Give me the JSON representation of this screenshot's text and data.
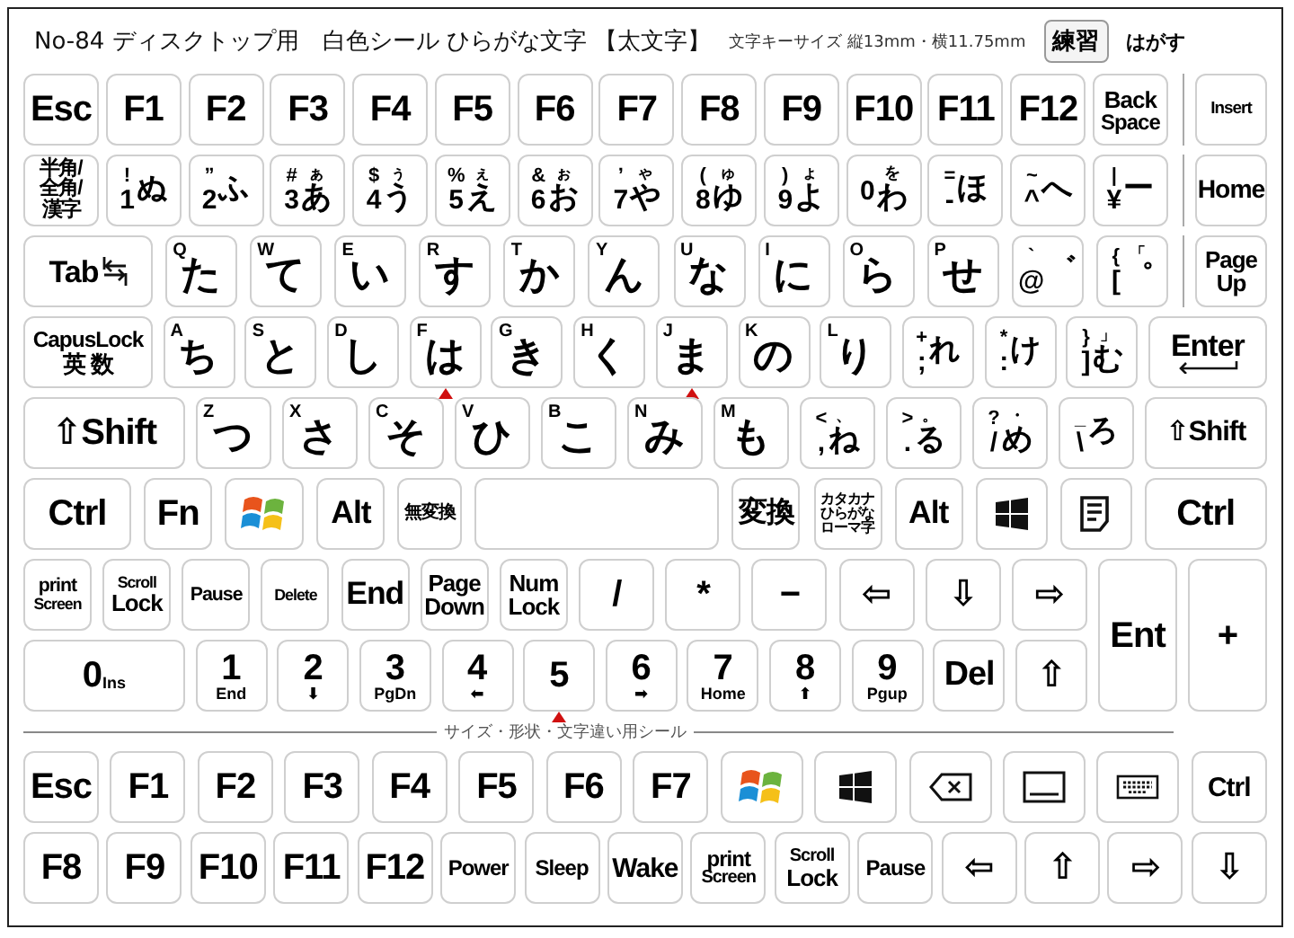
{
  "header": {
    "title": "No-84 ディスクトップ用　白色シール ひらがな文字 【太文字】",
    "size_note": "文字キーサイズ 縦13mm・横11.75mm",
    "practice": "練習",
    "peel": "はがす"
  },
  "rows": [
    {
      "keys": [
        {
          "kind": "label",
          "text": "Esc"
        },
        {
          "kind": "label",
          "text": "F1"
        },
        {
          "kind": "label",
          "text": "F2"
        },
        {
          "kind": "label",
          "text": "F3"
        },
        {
          "kind": "label",
          "text": "F4"
        },
        {
          "kind": "label",
          "text": "F5"
        },
        {
          "kind": "label",
          "text": "F6"
        },
        {
          "kind": "label",
          "text": "F7"
        },
        {
          "kind": "label",
          "text": "F8"
        },
        {
          "kind": "label",
          "text": "F9"
        },
        {
          "kind": "label",
          "text": "F10"
        },
        {
          "kind": "label",
          "text": "F11"
        },
        {
          "kind": "label",
          "text": "F12"
        },
        {
          "kind": "label",
          "lines": [
            "Back",
            "Space"
          ]
        }
      ],
      "side": {
        "kind": "label",
        "text": "Insert"
      }
    },
    {
      "keys": [
        {
          "kind": "label",
          "lines": [
            "半角/",
            "全角/",
            "漢字"
          ]
        },
        {
          "kind": "dual",
          "upper": "!",
          "lower": "1",
          "kana": "ぬ"
        },
        {
          "kind": "dual",
          "upper": "”",
          "lower": "2",
          "kana": "ふ"
        },
        {
          "kind": "dual",
          "upper": "#",
          "lower": "3",
          "kana": "あ",
          "kana_small": "ぁ"
        },
        {
          "kind": "dual",
          "upper": "$",
          "lower": "4",
          "kana": "う",
          "kana_small": "ぅ"
        },
        {
          "kind": "dual",
          "upper": "%",
          "lower": "5",
          "kana": "え",
          "kana_small": "ぇ"
        },
        {
          "kind": "dual",
          "upper": "&",
          "lower": "6",
          "kana": "お",
          "kana_small": "ぉ"
        },
        {
          "kind": "dual",
          "upper": "’",
          "lower": "7",
          "kana": "や",
          "kana_small": "ゃ"
        },
        {
          "kind": "dual",
          "upper": "(",
          "lower": "8",
          "kana": "ゆ",
          "kana_small": "ゅ"
        },
        {
          "kind": "dual",
          "upper": ")",
          "lower": "9",
          "kana": "よ",
          "kana_small": "ょ"
        },
        {
          "kind": "dual",
          "lower": "0",
          "kana": "わ",
          "kana_small": "を"
        },
        {
          "kind": "dual",
          "upper": "=",
          "lower": "-",
          "kana": "ほ"
        },
        {
          "kind": "dual",
          "upper": "~",
          "lower": "^",
          "kana": "へ"
        },
        {
          "kind": "dual",
          "upper": "|",
          "lower": "¥",
          "kana": "ー"
        }
      ],
      "side": {
        "kind": "label",
        "text": "Home"
      }
    },
    {
      "keys": [
        {
          "kind": "tab",
          "text": "Tab"
        },
        {
          "kind": "kana",
          "letter": "Q",
          "kana": "た"
        },
        {
          "kind": "kana",
          "letter": "W",
          "kana": "て"
        },
        {
          "kind": "kana",
          "letter": "E",
          "kana": "い"
        },
        {
          "kind": "kana",
          "letter": "R",
          "kana": "す"
        },
        {
          "kind": "kana",
          "letter": "T",
          "kana": "か"
        },
        {
          "kind": "kana",
          "letter": "Y",
          "kana": "ん"
        },
        {
          "kind": "kana",
          "letter": "U",
          "kana": "な"
        },
        {
          "kind": "kana",
          "letter": "I",
          "kana": "に"
        },
        {
          "kind": "kana",
          "letter": "O",
          "kana": "ら"
        },
        {
          "kind": "kana",
          "letter": "P",
          "kana": "せ"
        },
        {
          "kind": "dual",
          "upper": "`",
          "lower": "@",
          "kana": "゛"
        },
        {
          "kind": "dual",
          "upper": "{",
          "lower": "[",
          "kana": "゜",
          "kana_small": "「"
        }
      ],
      "side": {
        "kind": "label",
        "lines": [
          "Page",
          "Up"
        ]
      }
    },
    {
      "keys": [
        {
          "kind": "label",
          "lines": [
            "CapusLock",
            "英 数"
          ]
        },
        {
          "kind": "kana",
          "letter": "A",
          "kana": "ち"
        },
        {
          "kind": "kana",
          "letter": "S",
          "kana": "と"
        },
        {
          "kind": "kana",
          "letter": "D",
          "kana": "し"
        },
        {
          "kind": "kana",
          "letter": "F",
          "kana": "は",
          "bump": true
        },
        {
          "kind": "kana",
          "letter": "G",
          "kana": "き"
        },
        {
          "kind": "kana",
          "letter": "H",
          "kana": "く"
        },
        {
          "kind": "kana",
          "letter": "J",
          "kana": "ま",
          "bump": true
        },
        {
          "kind": "kana",
          "letter": "K",
          "kana": "の"
        },
        {
          "kind": "kana",
          "letter": "L",
          "kana": "り"
        },
        {
          "kind": "dual",
          "upper": "+",
          "lower": ";",
          "kana": "れ"
        },
        {
          "kind": "dual",
          "upper": "*",
          "lower": ":",
          "kana": "け"
        },
        {
          "kind": "dual",
          "upper": "}",
          "lower": "]",
          "kana": "む",
          "kana_small": "」"
        },
        {
          "kind": "enter",
          "text": "Enter"
        }
      ]
    },
    {
      "keys": [
        {
          "kind": "label",
          "text": "⇧Shift"
        },
        {
          "kind": "kana",
          "letter": "Z",
          "kana": "つ"
        },
        {
          "kind": "kana",
          "letter": "X",
          "kana": "さ"
        },
        {
          "kind": "kana",
          "letter": "C",
          "kana": "そ"
        },
        {
          "kind": "kana",
          "letter": "V",
          "kana": "ひ"
        },
        {
          "kind": "kana",
          "letter": "B",
          "kana": "こ"
        },
        {
          "kind": "kana",
          "letter": "N",
          "kana": "み"
        },
        {
          "kind": "kana",
          "letter": "M",
          "kana": "も"
        },
        {
          "kind": "dual",
          "upper": "<",
          "lower": ",",
          "kana": "ね",
          "kana_small": "、"
        },
        {
          "kind": "dual",
          "upper": ">",
          "lower": ".",
          "kana": "る",
          "kana_small": "。"
        },
        {
          "kind": "dual",
          "upper": "?",
          "lower": "/",
          "kana": "め",
          "kana_small": "・"
        },
        {
          "kind": "dual",
          "upper": "_",
          "lower": "\\",
          "kana": "ろ"
        },
        {
          "kind": "label",
          "text": "⇧Shift"
        }
      ]
    },
    {
      "keys": [
        {
          "kind": "label",
          "text": "Ctrl"
        },
        {
          "kind": "label",
          "text": "Fn"
        },
        {
          "kind": "winflag"
        },
        {
          "kind": "label",
          "text": "Alt"
        },
        {
          "kind": "label",
          "text": "無変換"
        },
        {
          "kind": "space"
        },
        {
          "kind": "label",
          "text": "変換"
        },
        {
          "kind": "label",
          "lines": [
            "カタカナ",
            "ひらがな",
            "ローマ字"
          ]
        },
        {
          "kind": "label",
          "text": "Alt"
        },
        {
          "kind": "win10"
        },
        {
          "kind": "menu"
        },
        {
          "kind": "label",
          "text": "Ctrl"
        }
      ]
    }
  ],
  "numpad": {
    "rows": [
      {
        "keys": [
          {
            "kind": "label",
            "lines": [
              "print",
              "Screen"
            ]
          },
          {
            "kind": "label",
            "lines": [
              "Scroll",
              "Lock"
            ]
          },
          {
            "kind": "label",
            "text": "Pause"
          },
          {
            "kind": "label",
            "text": "Delete"
          },
          {
            "kind": "label",
            "text": "End"
          },
          {
            "kind": "label",
            "lines": [
              "Page",
              "Down"
            ]
          },
          {
            "kind": "label",
            "lines": [
              "Num",
              "Lock"
            ]
          },
          {
            "kind": "label",
            "text": "/"
          },
          {
            "kind": "label",
            "text": "*"
          },
          {
            "kind": "label",
            "text": "−"
          },
          {
            "kind": "label",
            "text": "⇦"
          },
          {
            "kind": "label",
            "text": "⇩"
          },
          {
            "kind": "label",
            "text": "⇨"
          }
        ]
      },
      {
        "keys": [
          {
            "kind": "inline",
            "big": "0",
            "small": "Ins"
          },
          {
            "kind": "numpad",
            "digit": "1",
            "sub": "End"
          },
          {
            "kind": "numpad",
            "digit": "2",
            "sub": "⬇"
          },
          {
            "kind": "numpad",
            "digit": "3",
            "sub": "PgDn"
          },
          {
            "kind": "numpad",
            "digit": "4",
            "sub": "⬅"
          },
          {
            "kind": "numpad",
            "digit": "5",
            "bump": true
          },
          {
            "kind": "numpad",
            "digit": "6",
            "sub": "➡"
          },
          {
            "kind": "numpad",
            "digit": "7",
            "sub": "Home"
          },
          {
            "kind": "numpad",
            "digit": "8",
            "sub": "⬆"
          },
          {
            "kind": "numpad",
            "digit": "9",
            "sub": "Pgup"
          },
          {
            "kind": "label",
            "text": "Del"
          },
          {
            "kind": "label",
            "text": "⇧"
          }
        ]
      }
    ],
    "tall_keys": [
      {
        "kind": "label",
        "text": "Ent"
      },
      {
        "kind": "label",
        "text": "+"
      }
    ]
  },
  "spare": {
    "caption": "サイズ・形状・文字違い用シール",
    "rows": [
      {
        "keys": [
          {
            "kind": "label",
            "text": "Esc"
          },
          {
            "kind": "label",
            "text": "F1"
          },
          {
            "kind": "label",
            "text": "F2"
          },
          {
            "kind": "label",
            "text": "F3"
          },
          {
            "kind": "label",
            "text": "F4"
          },
          {
            "kind": "label",
            "text": "F5"
          },
          {
            "kind": "label",
            "text": "F6"
          },
          {
            "kind": "label",
            "text": "F7"
          },
          {
            "kind": "winflag"
          },
          {
            "kind": "win10"
          },
          {
            "kind": "bksp"
          },
          {
            "kind": "rect"
          },
          {
            "kind": "kbd"
          },
          {
            "kind": "label",
            "text": "Ctrl"
          }
        ]
      },
      {
        "keys": [
          {
            "kind": "label",
            "text": "F8"
          },
          {
            "kind": "label",
            "text": "F9"
          },
          {
            "kind": "label",
            "text": "F10"
          },
          {
            "kind": "label",
            "text": "F11"
          },
          {
            "kind": "label",
            "text": "F12"
          },
          {
            "kind": "label",
            "text": "Power"
          },
          {
            "kind": "label",
            "text": "Sleep"
          },
          {
            "kind": "label",
            "text": "Wake"
          },
          {
            "kind": "label",
            "lines": [
              "print",
              "Screen"
            ]
          },
          {
            "kind": "label",
            "lines": [
              "Scroll",
              "Lock"
            ]
          },
          {
            "kind": "label",
            "text": "Pause"
          },
          {
            "kind": "label",
            "text": "⇦"
          },
          {
            "kind": "label",
            "text": "⇧"
          },
          {
            "kind": "label",
            "text": "⇨"
          },
          {
            "kind": "label",
            "text": "⇩"
          }
        ]
      }
    ]
  }
}
